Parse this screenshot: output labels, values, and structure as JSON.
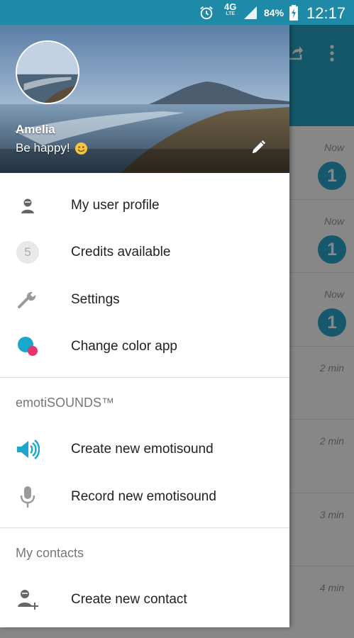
{
  "status_bar": {
    "network": "4G",
    "network_sub": "LTE",
    "battery": "84%",
    "time": "12:17"
  },
  "background_list": [
    {
      "time": "Now",
      "badge": "1"
    },
    {
      "time": "Now",
      "badge": "1"
    },
    {
      "time": "Now",
      "badge": "1"
    },
    {
      "time": "2 min",
      "badge": ""
    },
    {
      "time": "2 min",
      "badge": ""
    },
    {
      "time": "3 min",
      "badge": ""
    },
    {
      "time": "4 min",
      "badge": ""
    }
  ],
  "drawer": {
    "header": {
      "name": "Amelia",
      "status": "Be happy!"
    },
    "main_items": [
      {
        "label": "My user profile",
        "icon": "user-profile-icon"
      },
      {
        "label": "Credits available",
        "icon": "credits-icon",
        "value": "5"
      },
      {
        "label": "Settings",
        "icon": "wrench-icon"
      },
      {
        "label": "Change color app",
        "icon": "color-dots-icon"
      }
    ],
    "emotisounds": {
      "title": "emotiSOUNDS™",
      "items": [
        {
          "label": "Create new emotisound",
          "icon": "speaker-icon"
        },
        {
          "label": "Record new emotisound",
          "icon": "microphone-icon"
        }
      ]
    },
    "contacts": {
      "title": "My contacts",
      "items": [
        {
          "label": "Create new contact",
          "icon": "add-contact-icon"
        }
      ]
    }
  },
  "colors": {
    "accent": "#24a4c6",
    "status_bar": "#1f8aa7",
    "color_dot_primary": "#1aa7cc",
    "color_dot_secondary": "#e8356b"
  }
}
